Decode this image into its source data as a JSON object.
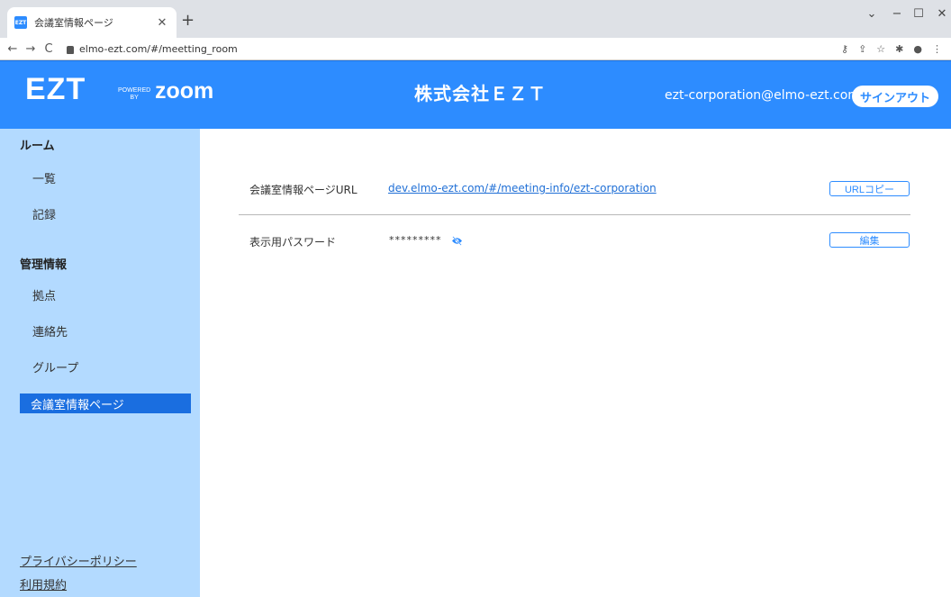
{
  "browser": {
    "tab_title": "会議室情報ページ",
    "favicon_text": "EZT",
    "url": "elmo-ezt.com/#/meetting_room"
  },
  "header": {
    "logo": "EZT",
    "powered_line1": "POWERED",
    "powered_line2": "BY",
    "zoom": "zoom",
    "company": "株式会社ＥＺＴ",
    "email": "ezt-corporation@elmo-ezt.com",
    "signout_label": "サインアウト",
    "brand_color": "#2d8cff"
  },
  "sidebar": {
    "section_room": "ルーム",
    "item_list": "一覧",
    "item_records": "記録",
    "section_admin": "管理情報",
    "item_sites": "拠点",
    "item_contacts": "連絡先",
    "item_groups": "グループ",
    "item_active": "会議室情報ページ",
    "privacy": "プライバシーポリシー",
    "terms": "利用規約"
  },
  "main": {
    "url_label": "会議室情報ページURL",
    "url_value": "dev.elmo-ezt.com/#/meeting-info/ezt-corporation",
    "copy_button": "URLコピー",
    "password_label": "表示用パスワード",
    "password_value": "*********",
    "edit_button": "編集"
  }
}
